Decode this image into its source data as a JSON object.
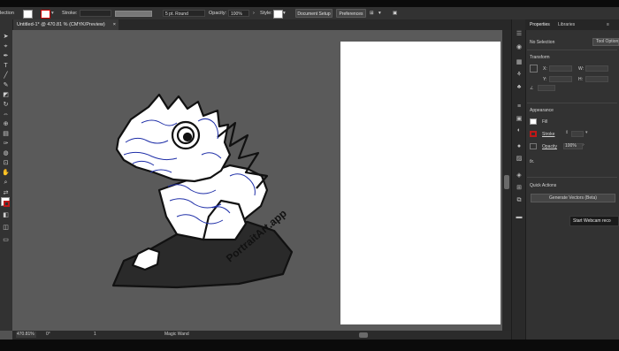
{
  "control_bar": {
    "mode_label": "lection",
    "stroke_label": "Stroke:",
    "brush_value": "5 pt. Round",
    "opacity_label": "Opacity:",
    "opacity_value": "100%",
    "style_label": "Style:",
    "document_setup": "Document Setup",
    "preferences": "Preferences"
  },
  "document_tab": {
    "title": "Untitled-1* @ 470.81 % (CMYK/Preview)",
    "close": "×"
  },
  "artwork": {
    "signature_text": "PortraitArt.app",
    "line_color": "#1f2fa8",
    "fill_color": "#ffffff"
  },
  "status_bar": {
    "zoom": "470.81%",
    "rotation": "0°",
    "page": "1",
    "tool": "Magic Wand"
  },
  "panel": {
    "tabs": [
      "Properties",
      "Libraries"
    ],
    "no_selection": "No Selection",
    "tool_options": "Tool Options",
    "transform_heading": "Transform",
    "transform_labels": [
      "X:",
      "W:",
      "Y:",
      "H:"
    ],
    "appearance_heading": "Appearance",
    "fill_label": "Fill",
    "stroke_label": "Stroke",
    "opacity_label": "Opacity",
    "opacity_value": "100%",
    "fx_label": "fx.",
    "quick_actions_heading": "Quick Actions",
    "generate_vectors": "Generate Vectors (Beta)"
  },
  "tooltip": {
    "text": "Start Webcam reco"
  }
}
